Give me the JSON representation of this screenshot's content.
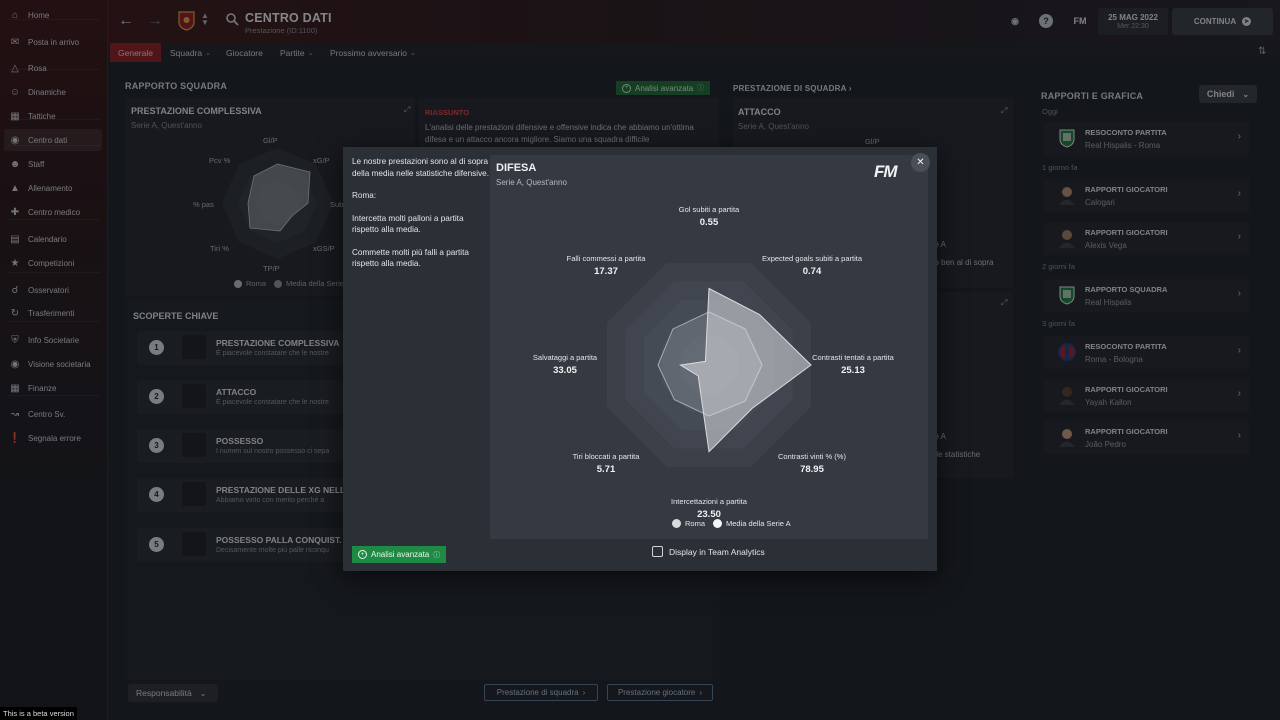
{
  "sidebar": {
    "items": [
      {
        "label": "Home",
        "icon": "home-icon"
      },
      {
        "label": "Posta in arrivo",
        "icon": "inbox-icon"
      },
      {
        "label": "Rosa",
        "icon": "shirt-icon"
      },
      {
        "label": "Dinamiche",
        "icon": "dynamics-icon"
      },
      {
        "label": "Tattiche",
        "icon": "tactics-icon"
      },
      {
        "label": "Centro dati",
        "icon": "data-center-icon"
      },
      {
        "label": "Staff",
        "icon": "staff-icon"
      },
      {
        "label": "Allenamento",
        "icon": "training-icon"
      },
      {
        "label": "Centro medico",
        "icon": "medical-icon"
      },
      {
        "label": "Calendario",
        "icon": "calendar-icon"
      },
      {
        "label": "Competizioni",
        "icon": "trophy-icon"
      },
      {
        "label": "Osservatori",
        "icon": "scouting-icon"
      },
      {
        "label": "Trasferimenti",
        "icon": "transfers-icon"
      },
      {
        "label": "Info Societarie",
        "icon": "club-info-icon"
      },
      {
        "label": "Visione societaria",
        "icon": "club-vision-icon"
      },
      {
        "label": "Finanze",
        "icon": "finances-icon"
      },
      {
        "label": "Centro Sv.",
        "icon": "development-icon"
      },
      {
        "label": "Segnala errore",
        "icon": "report-bug-icon"
      }
    ],
    "beta_note": "This is a beta version"
  },
  "header": {
    "title": "CENTRO DATI",
    "subtitle": "Prestazione (ID:1100)",
    "date": "25 MAG 2022",
    "time": "Mer 22:30",
    "fm_label": "FM",
    "continue_label": "CONTINUA"
  },
  "tabs": [
    {
      "label": "Generale",
      "dropdown": false
    },
    {
      "label": "Squadra",
      "dropdown": true
    },
    {
      "label": "Giocatore",
      "dropdown": false
    },
    {
      "label": "Partite",
      "dropdown": true
    },
    {
      "label": "Prossimo avversario",
      "dropdown": true
    }
  ],
  "left_panel": {
    "section_title": "RAPPORTO SQUADRA",
    "analysis_badge": "Analisi avanzata",
    "overall_title": "PRESTAZIONE COMPLESSIVA",
    "overall_sub": "Serie A, Quest'anno",
    "radar_labels": [
      "Gl/P",
      "xG/P",
      "Sub",
      "xGS/P",
      "TP/P",
      "Tiri %",
      "% pas",
      "Pcv %"
    ],
    "legend_roma": "Roma",
    "legend_media": "Media della Serie",
    "summary_title": "RIASSUNTO",
    "summary_text": "L'analisi delle prestazioni difensive e offensive indica che abbiamo un'ottima difesa e un attacco ancora migliore. Siamo una squadra difficile",
    "key_findings_title": "SCOPERTE CHIAVE",
    "findings": [
      {
        "num": "1",
        "title": "PRESTAZIONE COMPLESSIVA",
        "desc": "È piacevole constatare che le nostre"
      },
      {
        "num": "2",
        "title": "ATTACCO",
        "desc": "È piacevole constatare che le nostre"
      },
      {
        "num": "3",
        "title": "POSSESSO",
        "desc": "I numeri sul nostro possesso ci sepa"
      },
      {
        "num": "4",
        "title": "PRESTAZIONE DELLE XG NELL",
        "desc": "Abbiamo vinto con merito perché a"
      },
      {
        "num": "5",
        "title": "POSSESSO PALLA CONQUIST.",
        "desc": "Decisamente molte più palle riconqu"
      }
    ],
    "responsibility_label": "Responsabilità",
    "team_perf_btn": "Prestazione di squadra",
    "player_perf_btn": "Prestazione giocatore"
  },
  "middle_panel": {
    "section_title": "PRESTAZIONE DI SQUADRA",
    "attack_title": "ATTACCO",
    "attack_sub": "Serie A, Quest'anno",
    "attack_radar_label": "Gl/P",
    "snip_1": "rie A",
    "snip_2": "no ben al di sopra",
    "snip_3": "rie A",
    "snip_4": "alle statistiche"
  },
  "right_panel": {
    "section_title": "RAPPORTI E GRAFICA",
    "ask_label": "Chiedi",
    "groups": [
      {
        "label": "Oggi"
      },
      {
        "label": "1 giorno fa"
      },
      {
        "label": "2 giorni fa"
      },
      {
        "label": "3 giorni fa"
      }
    ],
    "reports": [
      {
        "title": "RESOCONTO PARTITA",
        "sub": "Real Hispalis - Roma",
        "avatar": "real-hispalis-badge-icon"
      },
      {
        "title": "RAPPORTI GIOCATORI",
        "sub": "Calogari",
        "avatar": "player-avatar-icon"
      },
      {
        "title": "RAPPORTI GIOCATORI",
        "sub": "Alexis Vega",
        "avatar": "player-avatar-icon"
      },
      {
        "title": "RAPPORTO SQUADRA",
        "sub": "Real Hispalis",
        "avatar": "real-hispalis-badge-icon"
      },
      {
        "title": "RESOCONTO PARTITA",
        "sub": "Roma - Bologna",
        "avatar": "bologna-badge-icon"
      },
      {
        "title": "RAPPORTI GIOCATORI",
        "sub": "Yayah Kallon",
        "avatar": "player-avatar-icon"
      },
      {
        "title": "RAPPORTI GIOCATORI",
        "sub": "João Pedro",
        "avatar": "player-avatar-icon"
      }
    ]
  },
  "modal": {
    "text": [
      "Le nostre prestazioni sono al di sopra della media nelle statistiche difensive.",
      "Roma:",
      "Intercetta molti palloni a partita rispetto alla media.",
      "Commette molti più falli a partita rispetto alla media."
    ],
    "chart_title": "DIFESA",
    "chart_subtitle": "Serie A, Quest'anno",
    "logo_text": "FM",
    "legend_roma": "Roma",
    "legend_media": "Media della Serie A",
    "analysis_button": "Analisi avanzata",
    "display_checkbox_label": "Display in Team Analytics",
    "display_checked": false
  },
  "chart_data": {
    "type": "radar",
    "title": "DIFESA",
    "subtitle": "Serie A, Quest'anno",
    "metrics": [
      {
        "label": "Gol subiti a partita",
        "value": "0.55",
        "roma": 0.75,
        "media": 0.52
      },
      {
        "label": "Expected goals subiti a partita",
        "value": "0.74",
        "roma": 0.7,
        "media": 0.5
      },
      {
        "label": "Contrasti tentati a partita",
        "value": "25.13",
        "roma": 1.0,
        "media": 0.52
      },
      {
        "label": "Contrasti vinti % (%)",
        "value": "78.95",
        "roma": 0.6,
        "media": 0.5
      },
      {
        "label": "Intercettazioni a partita",
        "value": "23.50",
        "roma": 0.85,
        "media": 0.5
      },
      {
        "label": "Tiri bloccati a partita",
        "value": "5.71",
        "roma": 0.15,
        "media": 0.48
      },
      {
        "label": "Salvataggi a partita",
        "value": "33.05",
        "roma": 0.28,
        "media": 0.5
      },
      {
        "label": "Falli commessi a partita",
        "value": "17.37",
        "roma": 0.05,
        "media": 0.5
      }
    ],
    "series": [
      {
        "name": "Roma"
      },
      {
        "name": "Media della Serie A"
      }
    ],
    "legend": "bottom",
    "colors": {
      "roma": "#d9dbdf",
      "media": "#a6abb3",
      "roma_fill": "rgba(220,222,226,0.55)",
      "media_fill": "rgba(140,146,156,0.35)"
    }
  },
  "colors": {
    "accent_red": "#8c1d22",
    "accent_green": "#1f8a44",
    "link_blue": "#aac2dc"
  }
}
